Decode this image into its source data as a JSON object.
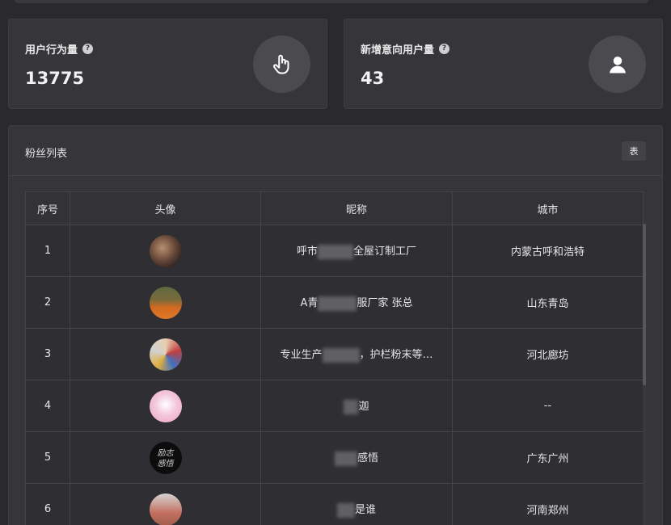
{
  "stats": [
    {
      "label": "用户行为量",
      "value": "13775",
      "icon": "pointer-hand-icon"
    },
    {
      "label": "新增意向用户量",
      "value": "43",
      "icon": "user-icon"
    }
  ],
  "fan_list": {
    "title": "粉丝列表",
    "table_button": "表",
    "columns": [
      "序号",
      "头像",
      "昵称",
      "城市"
    ],
    "rows": [
      {
        "index": "1",
        "nick_prefix": "呼市",
        "nick_suffix": "全屋订制工厂",
        "city": "内蒙古呼和浩特"
      },
      {
        "index": "2",
        "nick_prefix": "A青",
        "nick_suffix": "服厂家 张总",
        "city": "山东青岛"
      },
      {
        "index": "3",
        "nick_prefix": "专业生产",
        "nick_suffix": "，护栏粉末等…",
        "city": "河北廊坊"
      },
      {
        "index": "4",
        "nick_prefix": "",
        "nick_suffix": "迦",
        "city": "--"
      },
      {
        "index": "5",
        "nick_prefix": "",
        "nick_suffix": "感悟",
        "city": "广东广州"
      },
      {
        "index": "6",
        "nick_prefix": "",
        "nick_suffix": "是谁",
        "city": "河南郑州"
      }
    ]
  }
}
